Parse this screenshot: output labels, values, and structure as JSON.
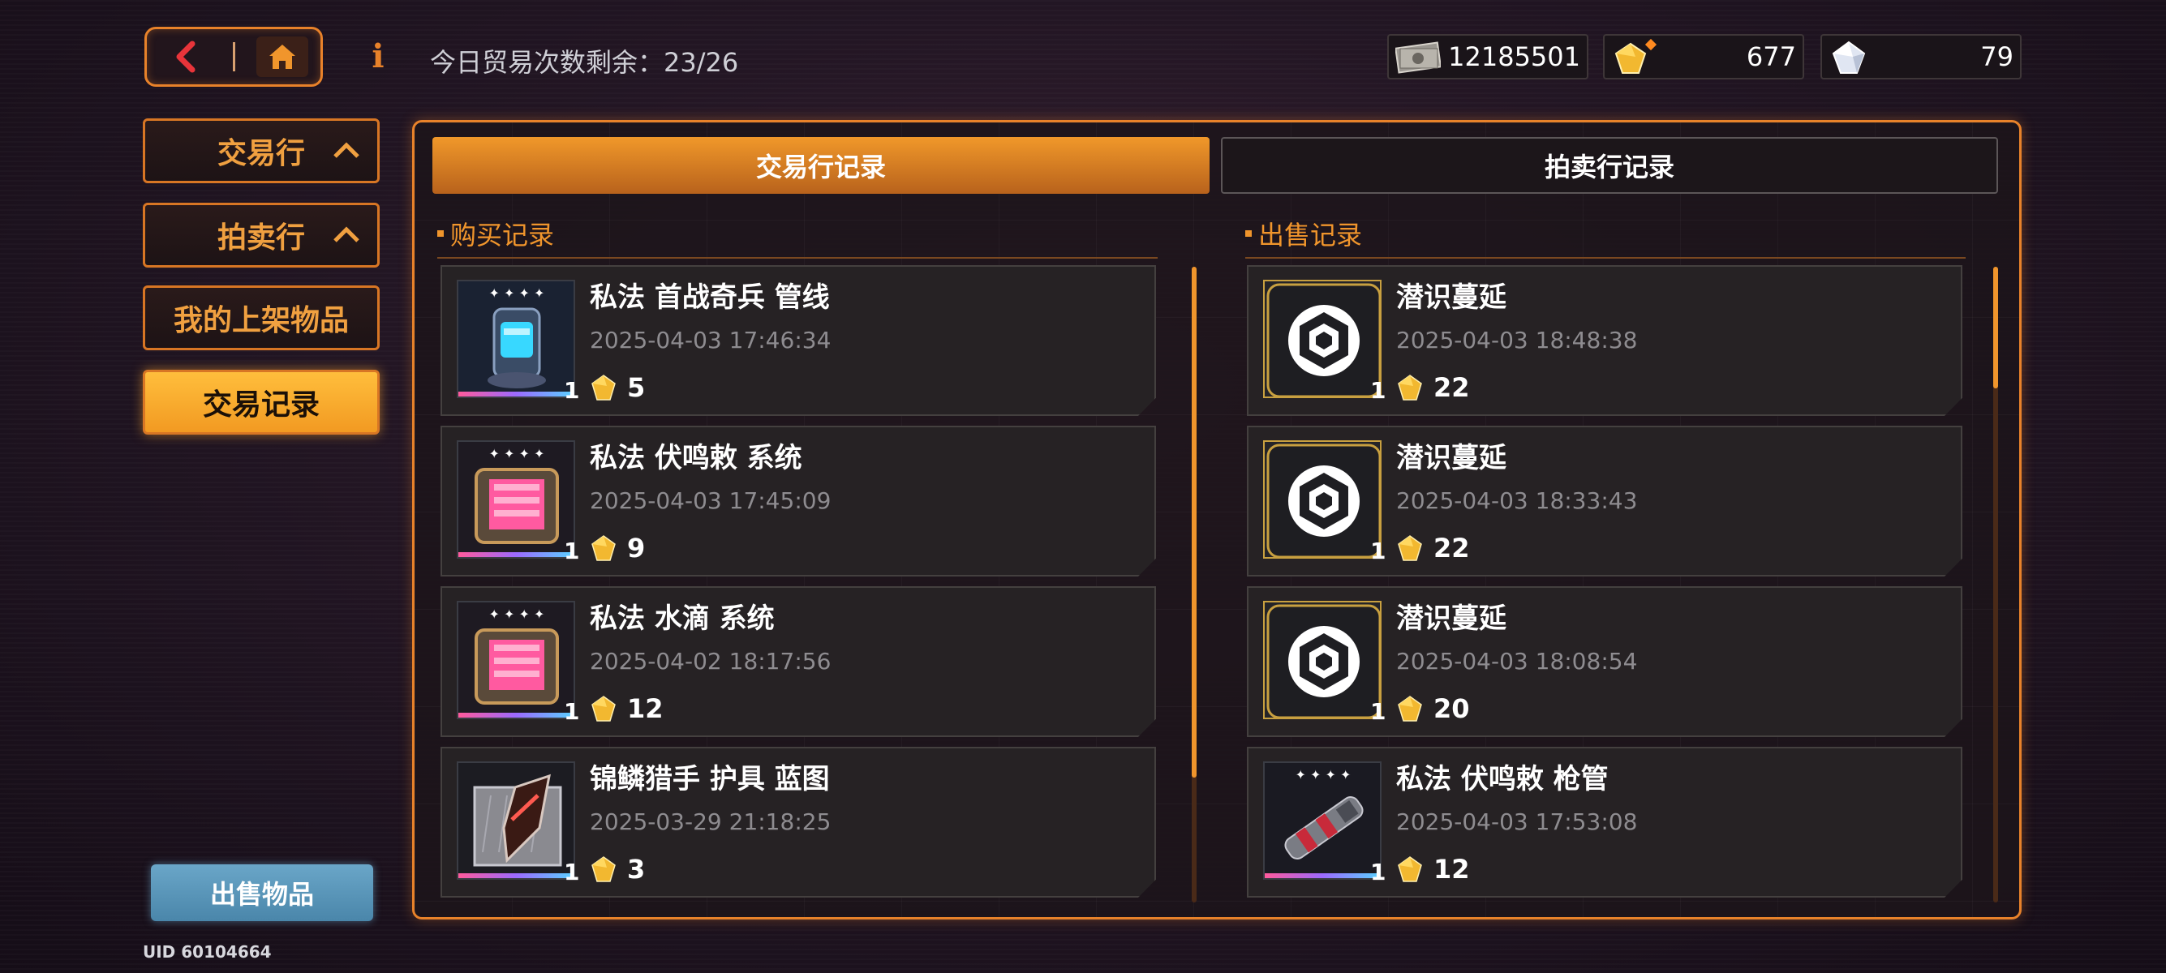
{
  "header": {
    "trade_remaining_label": "今日贸易次数剩余：23/26",
    "currencies": [
      {
        "icon": "banknote-icon",
        "value": "12185501"
      },
      {
        "icon": "gold-crystal-icon",
        "value": "677"
      },
      {
        "icon": "white-crystal-icon",
        "value": "79"
      }
    ]
  },
  "sidebar": {
    "items": [
      {
        "label": "交易行"
      },
      {
        "label": "拍卖行"
      },
      {
        "label": "我的上架物品"
      },
      {
        "label": "交易记录"
      }
    ],
    "sell_button": "出售物品",
    "uid": "UID 60104664"
  },
  "tabs": [
    {
      "label": "交易行记录",
      "active": true
    },
    {
      "label": "拍卖行记录",
      "active": false
    }
  ],
  "purchase": {
    "title": "购买记录",
    "records": [
      {
        "name": "私法 首战奇兵 管线",
        "time": "2025-04-03 17:46:34",
        "price": "5",
        "qty": "1",
        "icon": "pipeline-module-icon"
      },
      {
        "name": "私法 伏鸣敕 系统",
        "time": "2025-04-03 17:45:09",
        "price": "9",
        "qty": "1",
        "icon": "system-chip-icon"
      },
      {
        "name": "私法 水滴 系统",
        "time": "2025-04-02 18:17:56",
        "price": "12",
        "qty": "1",
        "icon": "system-chip-icon"
      },
      {
        "name": "锦鳞猎手 护具 蓝图",
        "time": "2025-03-29 21:18:25",
        "price": "3",
        "qty": "1",
        "icon": "armor-blueprint-icon"
      }
    ]
  },
  "sale": {
    "title": "出售记录",
    "records": [
      {
        "name": "潜识蔓延",
        "time": "2025-04-03 18:48:38",
        "price": "22",
        "qty": "1",
        "icon": "hexagon-emblem-icon"
      },
      {
        "name": "潜识蔓延",
        "time": "2025-04-03 18:33:43",
        "price": "22",
        "qty": "1",
        "icon": "hexagon-emblem-icon"
      },
      {
        "name": "潜识蔓延",
        "time": "2025-04-03 18:08:54",
        "price": "20",
        "qty": "1",
        "icon": "hexagon-emblem-icon"
      },
      {
        "name": "私法 伏鸣敕 枪管",
        "time": "2025-04-03 17:53:08",
        "price": "12",
        "qty": "1",
        "icon": "gun-barrel-icon"
      }
    ]
  }
}
